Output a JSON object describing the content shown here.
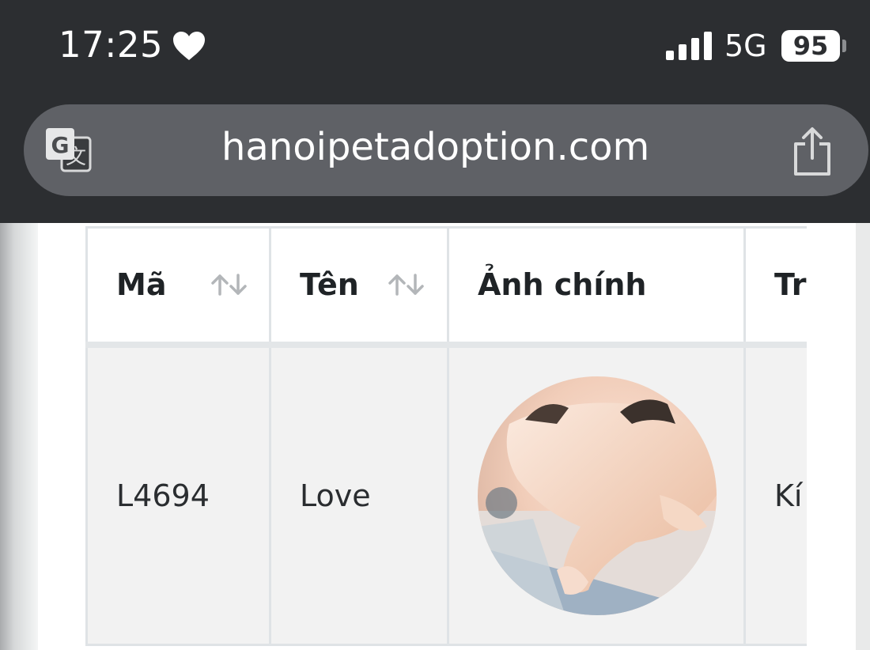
{
  "status_bar": {
    "time": "17:25",
    "network": "5G",
    "battery": "95",
    "icons": [
      "heart-icon",
      "signal-icon"
    ]
  },
  "address_bar": {
    "url": "hanoipetadoption.com",
    "icons": [
      "translate-icon",
      "share-icon"
    ]
  },
  "table": {
    "headers": [
      "Mã",
      "Tên",
      "Ảnh chính",
      "Tr"
    ],
    "sortable": [
      true,
      true,
      false,
      false
    ],
    "rows": [
      {
        "code": "L4694",
        "name": "Love",
        "photo": "cat-photo",
        "status": "Kí"
      }
    ]
  }
}
